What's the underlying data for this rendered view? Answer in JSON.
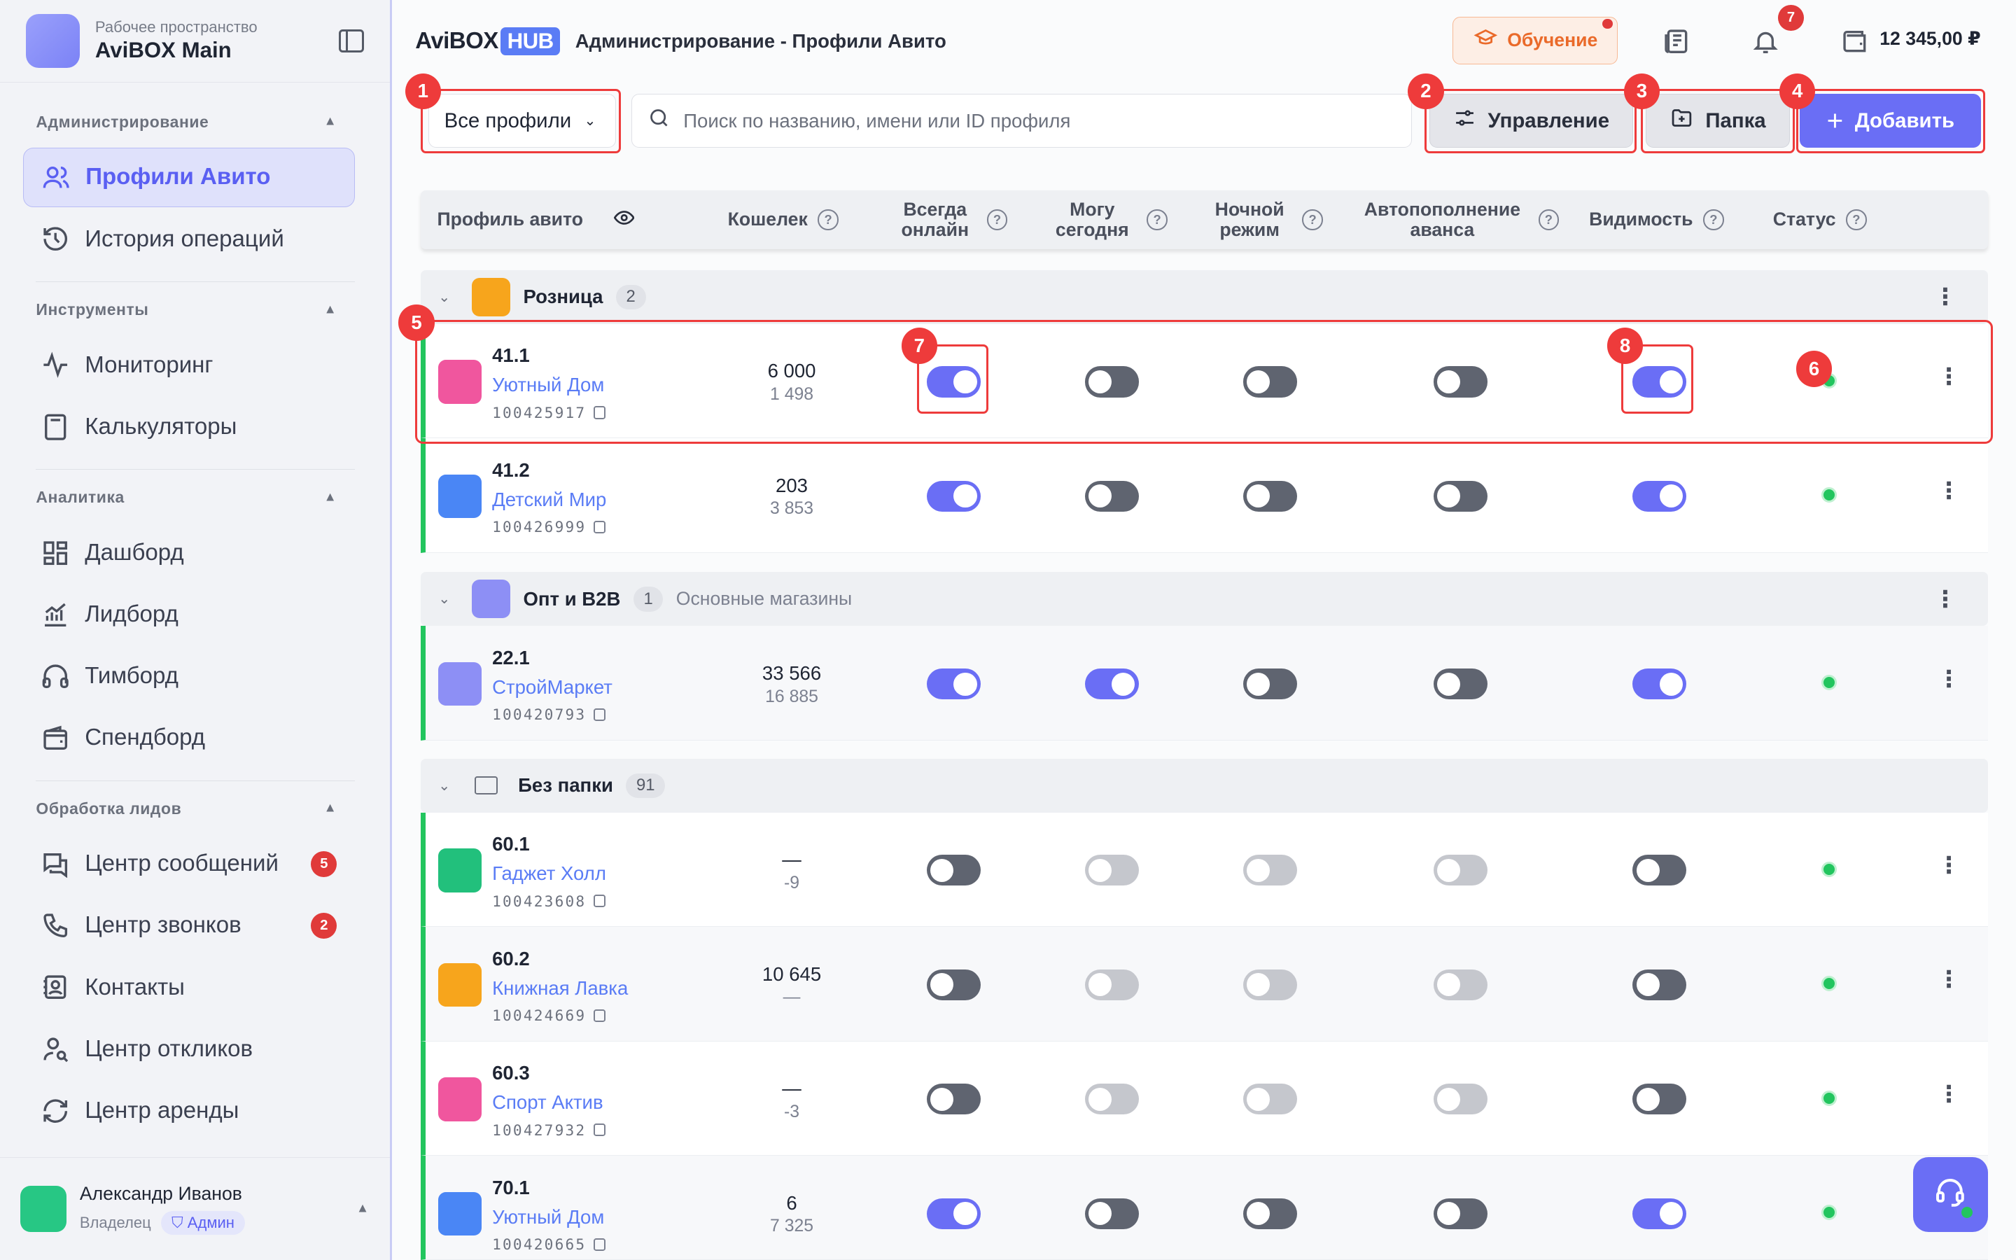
{
  "workspace": {
    "subtitle": "Рабочее пространство",
    "name": "AviBOX Main"
  },
  "sidebar": {
    "sections": [
      {
        "title": "Администрирование",
        "items": [
          {
            "label": "Профили Авито",
            "icon": "users-icon",
            "active": true
          },
          {
            "label": "История операций",
            "icon": "history-icon"
          }
        ]
      },
      {
        "title": "Инструменты",
        "items": [
          {
            "label": "Мониторинг",
            "icon": "activity-icon"
          },
          {
            "label": "Калькуляторы",
            "icon": "calculator-icon"
          }
        ]
      },
      {
        "title": "Аналитика",
        "items": [
          {
            "label": "Дашборд",
            "icon": "dashboard-icon"
          },
          {
            "label": "Лидборд",
            "icon": "chart-icon"
          },
          {
            "label": "Тимборд",
            "icon": "headphones-icon"
          },
          {
            "label": "Спендборд",
            "icon": "wallet-icon"
          }
        ]
      },
      {
        "title": "Обработка лидов",
        "items": [
          {
            "label": "Центр сообщений",
            "icon": "messages-icon",
            "badge": "5"
          },
          {
            "label": "Центр звонков",
            "icon": "phone-icon",
            "badge": "2"
          },
          {
            "label": "Контакты",
            "icon": "contacts-icon"
          },
          {
            "label": "Центр откликов",
            "icon": "user-search-icon"
          },
          {
            "label": "Центр аренды",
            "icon": "refresh-icon"
          }
        ]
      }
    ]
  },
  "user": {
    "name": "Александр Иванов",
    "role": "Владелец",
    "tag": "Админ"
  },
  "header": {
    "brand": "AviBOX",
    "brand_hub": "HUB",
    "title": "Администрирование - Профили Авито",
    "learn_label": "Обучение",
    "notifications_count": "7",
    "balance": "12 345,00 ₽"
  },
  "toolbar": {
    "filter_value": "Все профили",
    "search_placeholder": "Поиск по названию, имени или ID профиля",
    "manage_label": "Управление",
    "folder_label": "Папка",
    "add_label": "Добавить"
  },
  "columns": {
    "profile": "Профиль авито",
    "wallet": "Кошелек",
    "always_online_1": "Всегда",
    "always_online_2": "онлайн",
    "can_today_1": "Могу",
    "can_today_2": "сегодня",
    "night_1": "Ночной",
    "night_2": "режим",
    "autofill_1": "Автопополнение",
    "autofill_2": "аванса",
    "visibility": "Видимость",
    "status": "Статус"
  },
  "markers": [
    "1",
    "2",
    "3",
    "4",
    "5",
    "6",
    "7",
    "8"
  ],
  "groups": [
    {
      "name": "Розница",
      "count": "2",
      "color": "#f7a51c",
      "description": "",
      "rows": [
        {
          "num": "41.1",
          "name": "Уютный Дом",
          "id": "100425917",
          "w1": "6 000",
          "w2": "1 498",
          "color": "#f0569e",
          "t": [
            "on",
            "off",
            "off",
            "off",
            "on"
          ]
        },
        {
          "num": "41.2",
          "name": "Детский Мир",
          "id": "100426999",
          "w1": "203",
          "w2": "3 853",
          "color": "#4a86f5",
          "t": [
            "on",
            "off",
            "off",
            "off",
            "on"
          ]
        }
      ]
    },
    {
      "name": "Опт и B2B",
      "count": "1",
      "color": "#8d8ff5",
      "description": "Основные магазины",
      "rows": [
        {
          "num": "22.1",
          "name": "СтройМаркет",
          "id": "100420793",
          "w1": "33 566",
          "w2": "16 885",
          "color": "#8d8ff5",
          "t": [
            "on",
            "on",
            "off",
            "off",
            "on"
          ]
        }
      ]
    },
    {
      "name": "Без папки",
      "count": "91",
      "color": "",
      "description": "",
      "rows": [
        {
          "num": "60.1",
          "name": "Гаджет Холл",
          "id": "100423608",
          "w1": "—",
          "w2": "-9",
          "color": "#22c07c",
          "t": [
            "off",
            "dis",
            "dis",
            "dis",
            "off"
          ]
        },
        {
          "num": "60.2",
          "name": "Книжная Лавка",
          "id": "100424669",
          "w1": "10 645",
          "w2": "—",
          "color": "#f7a51c",
          "t": [
            "off",
            "dis",
            "dis",
            "dis",
            "off"
          ]
        },
        {
          "num": "60.3",
          "name": "Спорт Актив",
          "id": "100427932",
          "w1": "—",
          "w2": "-3",
          "color": "#f0569e",
          "t": [
            "off",
            "dis",
            "dis",
            "dis",
            "off"
          ]
        },
        {
          "num": "70.1",
          "name": "Уютный Дом",
          "id": "100420665",
          "w1": "6",
          "w2": "7 325",
          "color": "#4a86f5",
          "t": [
            "on",
            "off",
            "off",
            "off",
            "on"
          ]
        }
      ]
    }
  ]
}
